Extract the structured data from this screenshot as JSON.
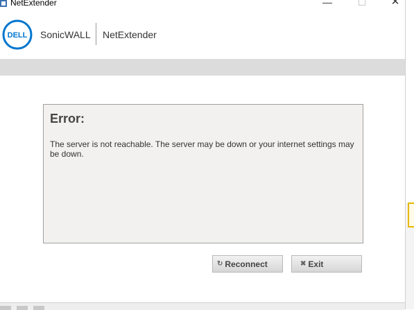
{
  "window": {
    "title": "NetExtender",
    "controls": {
      "minimize": "—",
      "maximize": "☐",
      "close": "✕"
    }
  },
  "header": {
    "logo_text": "DELL",
    "brand_primary": "SonicWALL",
    "brand_secondary": "NetExtender"
  },
  "error": {
    "title": "Error:",
    "message": "The server is not reachable. The server may be down or your internet settings may be down."
  },
  "buttons": {
    "reconnect": {
      "label": "Reconnect",
      "icon": "refresh-icon"
    },
    "exit": {
      "label": "Exit",
      "icon": "x-icon"
    }
  },
  "colors": {
    "dell_blue": "#0076ce",
    "gray_bar": "#dcdcdc",
    "panel_bg": "#f2f1f0"
  }
}
